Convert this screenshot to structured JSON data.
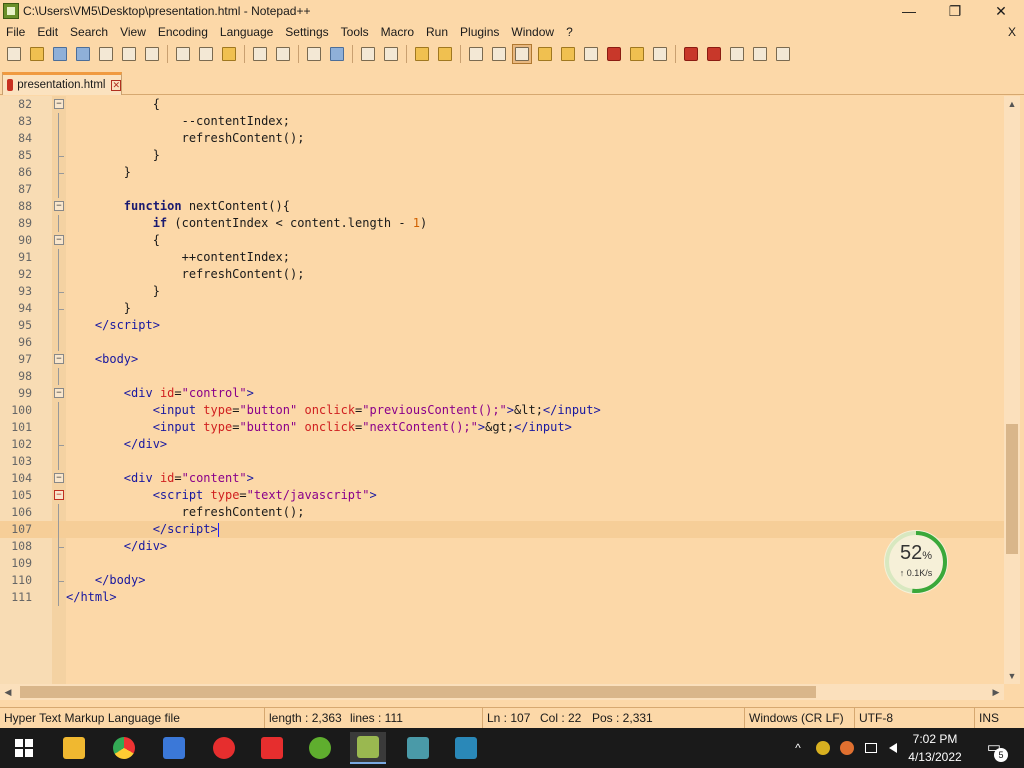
{
  "window": {
    "title": "C:\\Users\\VM5\\Desktop\\presentation.html - Notepad++",
    "minimize": "—",
    "restore": "❐",
    "close": "✕"
  },
  "menu": {
    "items": [
      "File",
      "Edit",
      "Search",
      "View",
      "Encoding",
      "Language",
      "Settings",
      "Tools",
      "Macro",
      "Run",
      "Plugins",
      "Window",
      "?"
    ],
    "close_doc": "X"
  },
  "toolbar": {
    "icons": [
      "new-file-icon",
      "open-file-icon",
      "save-icon",
      "save-all-icon",
      "close-icon",
      "close-all-icon",
      "print-icon",
      "cut-icon",
      "copy-icon",
      "paste-icon",
      "undo-icon",
      "redo-icon",
      "find-icon",
      "replace-icon",
      "zoom-in-icon",
      "zoom-out-icon",
      "sync-v-icon",
      "sync-h-icon",
      "wrap-icon",
      "show-all-icon",
      "indent-guide-icon",
      "lang-icon",
      "doc-map-icon",
      "func-list-icon",
      "folder-icon",
      "monitor-icon",
      "record-macro-icon",
      "stop-macro-icon",
      "play-macro-icon",
      "run-macro-icon",
      "save-macro-icon"
    ]
  },
  "tab": {
    "label": "presentation.html",
    "close": "✕"
  },
  "editor": {
    "lines": [
      {
        "n": "82",
        "html": "            {"
      },
      {
        "n": "83",
        "html": "                --contentIndex;"
      },
      {
        "n": "84",
        "html": "                refreshContent();"
      },
      {
        "n": "85",
        "html": "            }"
      },
      {
        "n": "86",
        "html": "        }"
      },
      {
        "n": "87",
        "html": ""
      },
      {
        "n": "88",
        "html": "        <span class=\"kw\">function</span> nextContent(){"
      },
      {
        "n": "89",
        "html": "            <span class=\"kw\">if</span> (contentIndex &lt; content.length - <span class=\"num\">1</span>)"
      },
      {
        "n": "90",
        "html": "            {"
      },
      {
        "n": "91",
        "html": "                ++contentIndex;"
      },
      {
        "n": "92",
        "html": "                refreshContent();"
      },
      {
        "n": "93",
        "html": "            }"
      },
      {
        "n": "94",
        "html": "        }"
      },
      {
        "n": "95",
        "html": "    <span class=\"tag\">&lt;/script&gt;</span>"
      },
      {
        "n": "96",
        "html": ""
      },
      {
        "n": "97",
        "html": "    <span class=\"tag\">&lt;body&gt;</span>"
      },
      {
        "n": "98",
        "html": ""
      },
      {
        "n": "99",
        "html": "        <span class=\"tag\">&lt;div</span> <span class=\"attr\">id</span>=<span class=\"str\">\"control\"</span><span class=\"tag\">&gt;</span>"
      },
      {
        "n": "100",
        "html": "            <span class=\"tag\">&lt;input</span> <span class=\"attr\">type</span>=<span class=\"str\">\"button\"</span> <span class=\"attr\">onclick</span>=<span class=\"str\">\"previousContent();\"</span><span class=\"tag\">&gt;</span>&amp;lt;<span class=\"tag\">&lt;/input&gt;</span>"
      },
      {
        "n": "101",
        "html": "            <span class=\"tag\">&lt;input</span> <span class=\"attr\">type</span>=<span class=\"str\">\"button\"</span> <span class=\"attr\">onclick</span>=<span class=\"str\">\"nextContent();\"</span><span class=\"tag\">&gt;</span>&amp;gt;<span class=\"tag\">&lt;/input&gt;</span>"
      },
      {
        "n": "102",
        "html": "        <span class=\"tag\">&lt;/div&gt;</span>"
      },
      {
        "n": "103",
        "html": ""
      },
      {
        "n": "104",
        "html": "        <span class=\"tag\">&lt;div</span> <span class=\"attr\">id</span>=<span class=\"str\">\"content\"</span><span class=\"tag\">&gt;</span>"
      },
      {
        "n": "105",
        "html": "            <span class=\"tag\">&lt;script</span> <span class=\"attr\">type</span>=<span class=\"str\">\"text/javascript\"</span><span class=\"tag\">&gt;</span>"
      },
      {
        "n": "106",
        "html": "                refreshContent();"
      },
      {
        "n": "107",
        "html": "            <span class=\"tag\">&lt;/script&gt;</span><span class=\"caret\"></span>"
      },
      {
        "n": "108",
        "html": "        <span class=\"tag\">&lt;/div&gt;</span>"
      },
      {
        "n": "109",
        "html": ""
      },
      {
        "n": "110",
        "html": "    <span class=\"tag\">&lt;/body&gt;</span>"
      },
      {
        "n": "111",
        "html": "<span class=\"tag\">&lt;/html&gt;</span>"
      }
    ],
    "current_line": "107"
  },
  "scroll": {
    "up": "▲",
    "down": "▼",
    "left": "◀",
    "right": "▶"
  },
  "status": {
    "file_type": "Hyper Text Markup Language file",
    "length": "length : 2,363",
    "lines": "lines : 111",
    "ln": "Ln : 107",
    "col": "Col : 22",
    "pos": "Pos : 2,331",
    "eol": "Windows (CR LF)",
    "encoding": "UTF-8",
    "mode": "INS"
  },
  "widget": {
    "percent": "52",
    "percent_sign": "%",
    "speed": "↑ 0.1K/s",
    "fraction": 0.52
  },
  "taskbar": {
    "apps": [
      "windows-start-icon",
      "file-explorer-icon",
      "chrome-icon",
      "app-icon",
      "yandex-browser-icon",
      "yandex-icon",
      "green-app-icon",
      "notepadpp-icon",
      "monitor-app-icon",
      "window-app-icon"
    ],
    "time": "7:02 PM",
    "date": "4/13/2022",
    "notifications": "5"
  },
  "colors": {
    "background": "#fcd8a8",
    "taskbar": "#1a1a1a",
    "tab_accent": "#f09a40",
    "widget_ring": "#3aa83a"
  }
}
